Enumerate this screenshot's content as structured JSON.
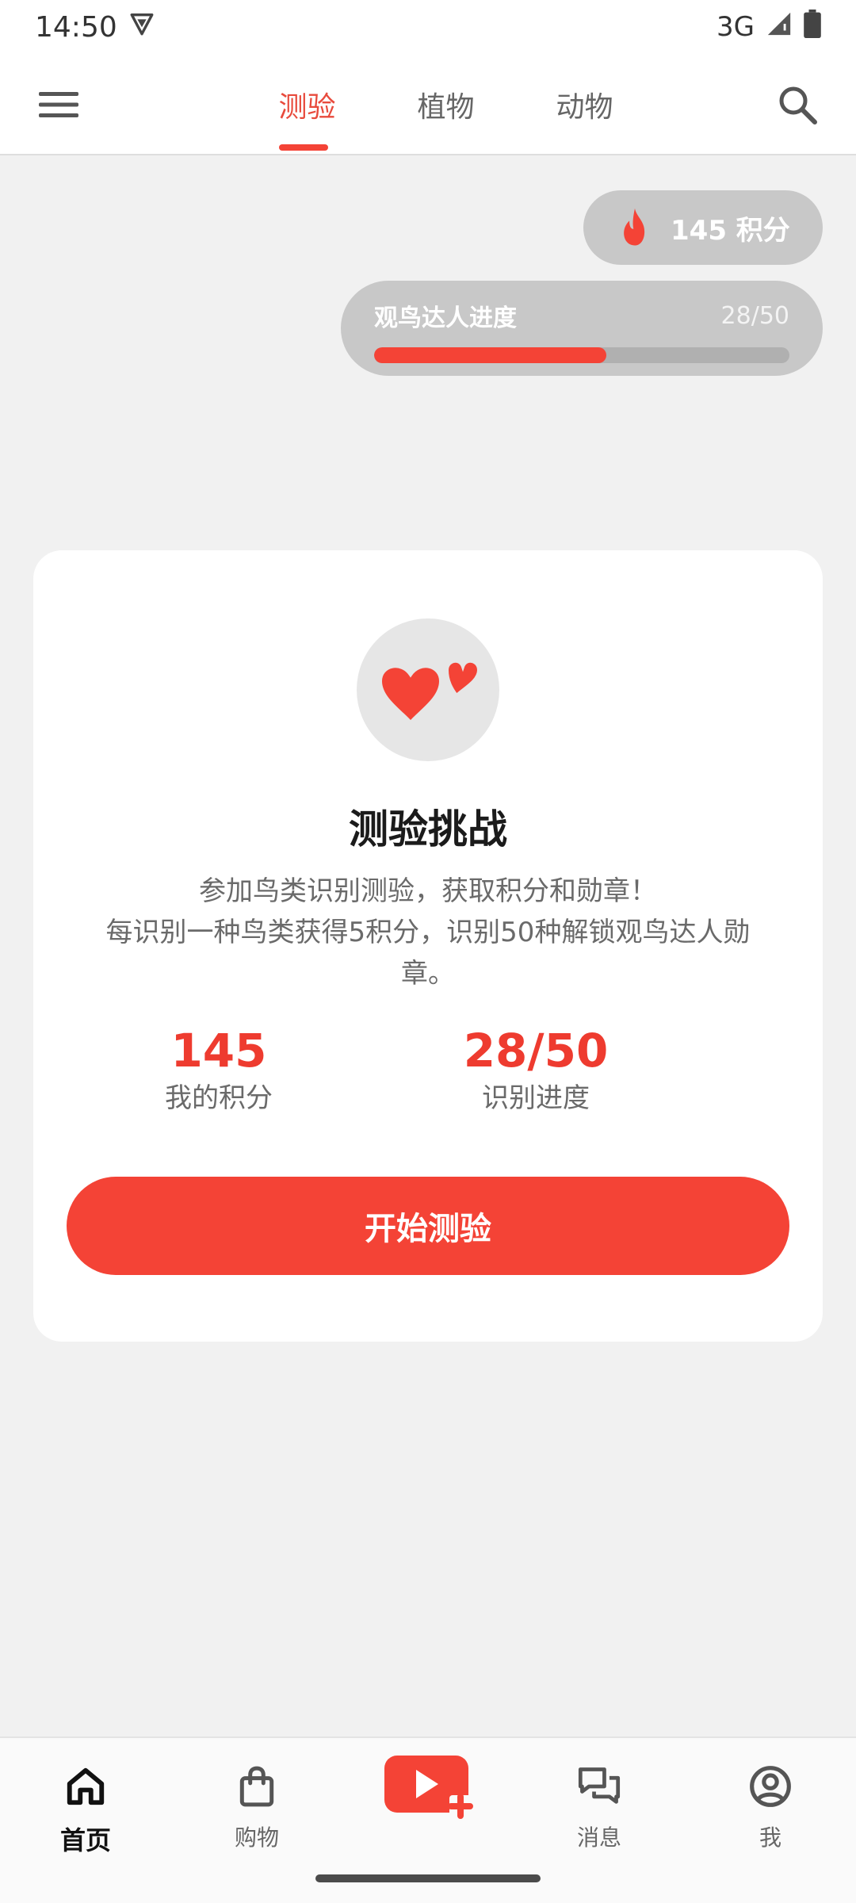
{
  "status_bar": {
    "time": "14:50",
    "network": "3G"
  },
  "top_bar": {
    "tabs": [
      {
        "label": "测验",
        "active": true
      },
      {
        "label": "植物",
        "active": false
      },
      {
        "label": "动物",
        "active": false
      }
    ]
  },
  "points_pill": {
    "text": "145 积分",
    "icon": "fire-icon"
  },
  "progress_card": {
    "title": "观鸟达人进度",
    "count": "28/50",
    "value": 28,
    "max": 50
  },
  "quiz_card": {
    "icon": "hearts-icon",
    "title": "测验挑战",
    "description": "参加鸟类识别测验，获取积分和勋章！\n每识别一种鸟类获得5积分，识别50种解锁观鸟达人勋章。",
    "stats": [
      {
        "value": "145",
        "label": "我的积分"
      },
      {
        "value": "28/50",
        "label": "识别进度"
      }
    ],
    "start_button": "开始测验"
  },
  "bottom_nav": {
    "items": [
      {
        "label": "首页",
        "icon": "home-icon",
        "active": true
      },
      {
        "label": "购物",
        "icon": "shopping-bag-icon",
        "active": false
      },
      {
        "label": "",
        "icon": "create-video-icon",
        "active": false
      },
      {
        "label": "消息",
        "icon": "chat-bubbles-icon",
        "active": false
      },
      {
        "label": "我",
        "icon": "profile-icon",
        "active": false
      }
    ]
  },
  "colors": {
    "accent": "#f44336",
    "accent_text": "#ee3b2f",
    "pill_bg": "#c8c8c8",
    "background": "#f1f1f1"
  }
}
